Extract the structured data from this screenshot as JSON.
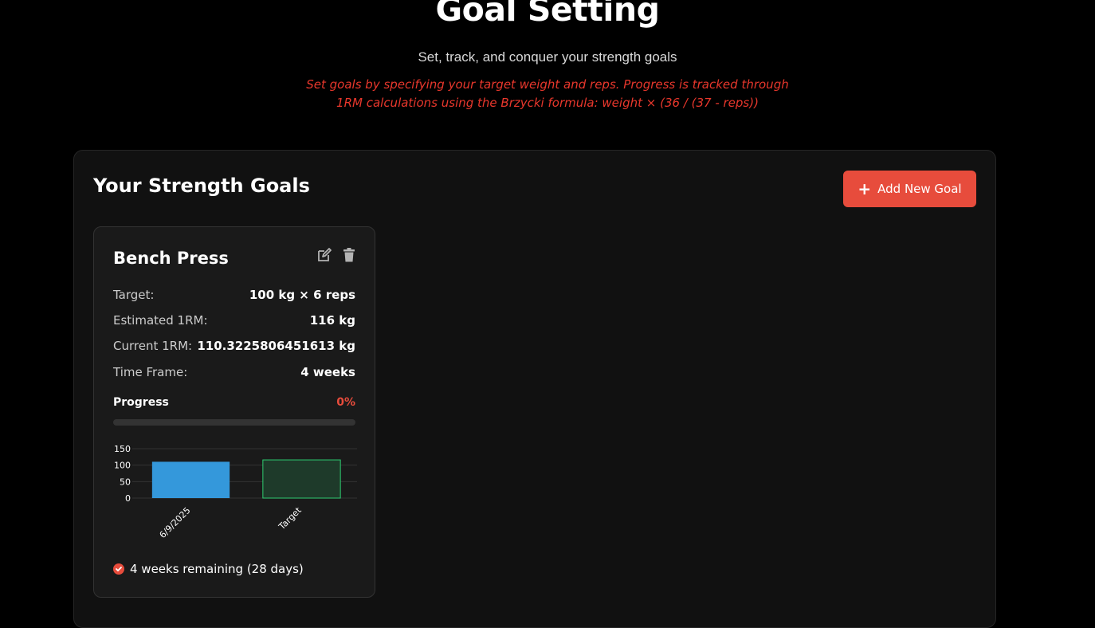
{
  "header": {
    "title": "Goal Setting",
    "subtitle": "Set, track, and conquer your strength goals",
    "note_line1": "Set goals by specifying your target weight and reps. Progress is tracked through",
    "note_line2": "1RM calculations using the Brzycki formula: weight × (36 / (37 - reps))"
  },
  "panel": {
    "title": "Your Strength Goals",
    "add_button_label": "Add New Goal",
    "add_button_icon": "plus-icon"
  },
  "goal": {
    "name": "Bench Press",
    "edit_icon": "edit-icon",
    "delete_icon": "trash-icon",
    "stats": [
      {
        "label": "Target:",
        "value": "100 kg × 6 reps"
      },
      {
        "label": "Estimated 1RM:",
        "value": "116 kg"
      },
      {
        "label": "Current 1RM:",
        "value": "110.3225806451613 kg"
      },
      {
        "label": "Time Frame:",
        "value": "4 weeks"
      }
    ],
    "progress_label": "Progress",
    "progress_value": "0%",
    "progress_fraction": 0,
    "remaining_text": "4 weeks remaining (28 days)",
    "remaining_icon": "check-circle-icon"
  },
  "colors": {
    "accent": "#e74c3c",
    "bar_current": "#3498db",
    "bar_target_fill": "#1e3a2a",
    "bar_target_stroke": "#2ecc71"
  },
  "chart_data": {
    "type": "bar",
    "categories": [
      "6/9/2025",
      "Target"
    ],
    "values": [
      110.32,
      116
    ],
    "yticks": [
      0,
      50,
      100,
      150
    ],
    "ylim": [
      0,
      150
    ],
    "grid": true,
    "legend": "none"
  }
}
